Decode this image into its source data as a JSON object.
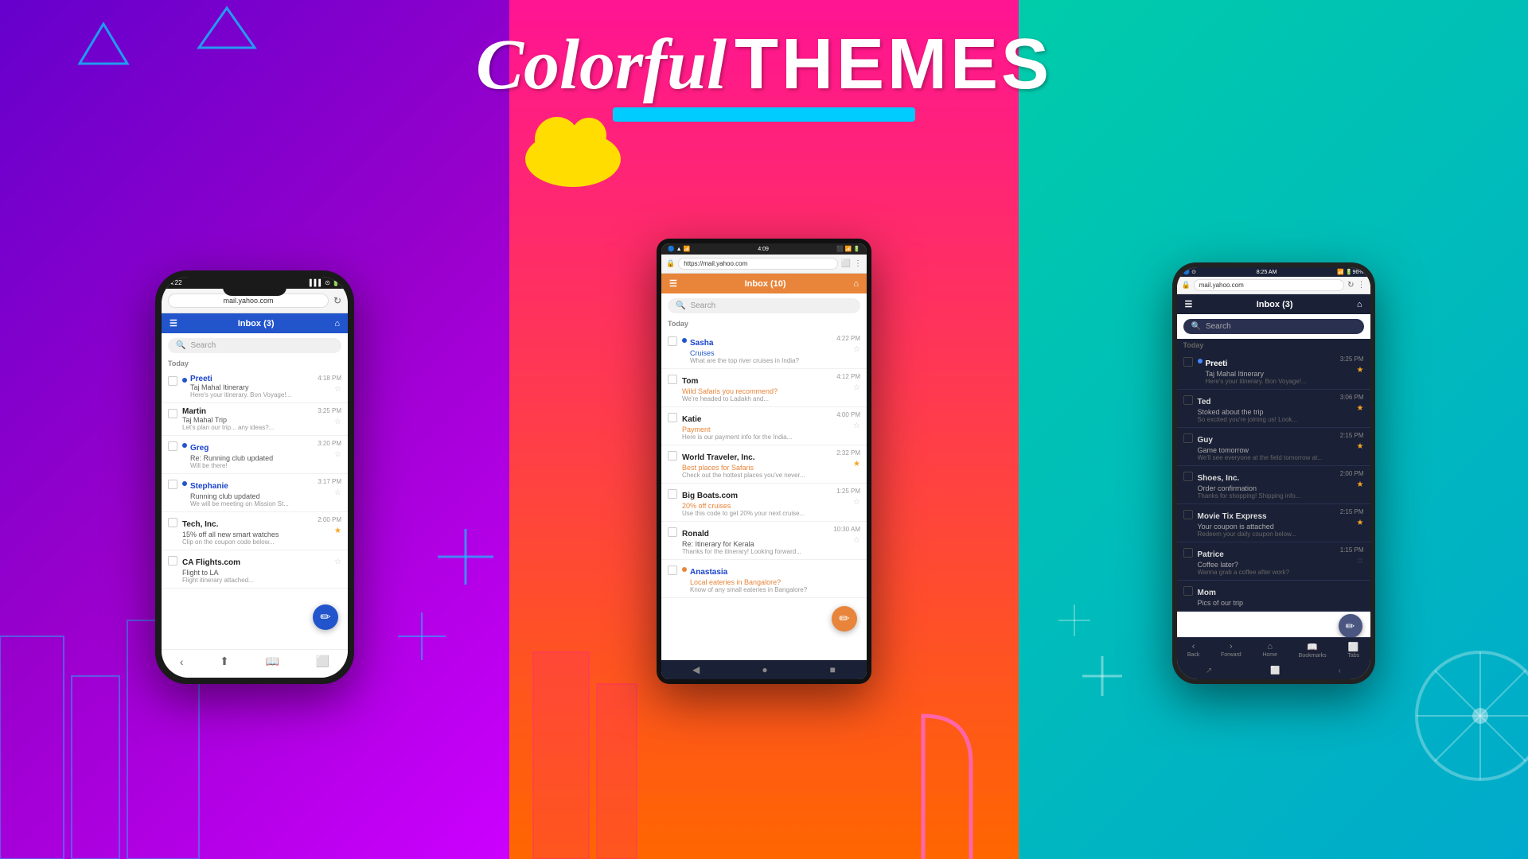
{
  "header": {
    "colorful_text": "Colorful",
    "themes_text": "THEMES"
  },
  "panel_left": {
    "phone": {
      "status_time": "4:22",
      "url": "mail.yahoo.com",
      "inbox_title": "Inbox (3)",
      "search_placeholder": "Search",
      "section_today": "Today",
      "emails": [
        {
          "sender": "Preeti",
          "subject": "Taj Mahal Itinerary",
          "preview": "Here's your itinerary. Bon Voyage!...",
          "time": "4:18 PM",
          "unread": true,
          "starred": false
        },
        {
          "sender": "Martin",
          "subject": "Taj Mahal Trip",
          "preview": "Let's plan our trip... any ideas?...",
          "time": "3:25 PM",
          "unread": false,
          "starred": false
        },
        {
          "sender": "Greg",
          "subject": "Re: Running club updated",
          "preview": "Will be there!",
          "time": "3:20 PM",
          "unread": true,
          "starred": false
        },
        {
          "sender": "Stephanie",
          "subject": "Running club updated",
          "preview": "We will be meeting on Mission St...",
          "time": "3:17 PM",
          "unread": true,
          "starred": false
        },
        {
          "sender": "Tech, Inc.",
          "subject": "15% off all new smart watches",
          "preview": "Clip on the coupon code below...",
          "time": "2:00 PM",
          "unread": false,
          "starred": true
        },
        {
          "sender": "CA Flights.com",
          "subject": "Flight to LA",
          "preview": "Flight itinerary attached...",
          "time": "",
          "unread": false,
          "starred": false
        }
      ]
    }
  },
  "panel_middle": {
    "phone": {
      "status_time": "4:09",
      "url": "https://mail.yahoo.com",
      "inbox_title": "Inbox (10)",
      "search_placeholder": "Search",
      "section_today": "Today",
      "emails": [
        {
          "sender": "Sasha",
          "subject": "Cruises",
          "preview": "What are the top river cruises in India?",
          "time": "4:22 PM",
          "unread": true,
          "starred": false,
          "subject_color": "blue"
        },
        {
          "sender": "Tom",
          "subject": "Wild Safaris you recommend?",
          "preview": "We're headed to Ladakh and...",
          "time": "4:12 PM",
          "unread": false,
          "starred": false,
          "subject_color": "orange"
        },
        {
          "sender": "Katie",
          "subject": "Payment",
          "preview": "Here is our payment info for the India...",
          "time": "4:00 PM",
          "unread": false,
          "starred": false,
          "subject_color": "orange"
        },
        {
          "sender": "World Traveler, Inc.",
          "subject": "Best places for Safaris",
          "preview": "Check out the hottest places you've never...",
          "time": "2:32 PM",
          "unread": false,
          "starred": true,
          "subject_color": "orange"
        },
        {
          "sender": "Big Boats.com",
          "subject": "20% off cruises",
          "preview": "Use this code to get 20% your next cruise...",
          "time": "1:25 PM",
          "unread": false,
          "starred": false,
          "subject_color": "orange"
        },
        {
          "sender": "Ronald",
          "subject": "Re: Itinerary for Kerala",
          "preview": "Thanks for the itinerary! Looking forward...",
          "time": "10:30 AM",
          "unread": false,
          "starred": false,
          "subject_color": ""
        },
        {
          "sender": "Anastasia",
          "subject": "Local eateries in Bangalore?",
          "preview": "Know of any small eateries in Bangalore?",
          "time": "",
          "unread": true,
          "starred": false,
          "subject_color": "orange"
        }
      ]
    }
  },
  "panel_right": {
    "phone": {
      "status_time": "8:25 AM",
      "battery": "96%",
      "url": "mail.yahoo.com",
      "inbox_title": "Inbox (3)",
      "search_placeholder": "Search",
      "section_today": "Today",
      "emails": [
        {
          "sender": "Preeti",
          "subject": "Taj Mahal Itinerary",
          "preview": "Here's your itinerary. Bon Voyage!...",
          "time": "3:25 PM",
          "unread": true,
          "starred": true
        },
        {
          "sender": "Ted",
          "subject": "Stoked about the trip",
          "preview": "So excited you're joining us! Look...",
          "time": "3:06 PM",
          "unread": false,
          "starred": true
        },
        {
          "sender": "Guy",
          "subject": "Game tomorrow",
          "preview": "We'll see everyone at the field tomorrow at...",
          "time": "2:15 PM",
          "unread": false,
          "starred": true
        },
        {
          "sender": "Shoes, Inc.",
          "subject": "Order confirmation",
          "preview": "Thanks for shopping! Shipping info...",
          "time": "2:00 PM",
          "unread": false,
          "starred": true
        },
        {
          "sender": "Movie Tix Express",
          "subject": "Your coupon is attached",
          "preview": "Redeem your daily coupon below...",
          "time": "2:15 PM",
          "unread": false,
          "starred": true
        },
        {
          "sender": "Patrice",
          "subject": "Coffee later?",
          "preview": "Wanna grab a coffee after work?",
          "time": "1:15 PM",
          "unread": false,
          "starred": false
        },
        {
          "sender": "Mom",
          "subject": "Pics of our trip",
          "preview": "",
          "time": "",
          "unread": false,
          "starred": false
        }
      ],
      "nav_items": [
        "Back",
        "Forward",
        "Home",
        "Bookmarks",
        "Tabs"
      ]
    }
  }
}
